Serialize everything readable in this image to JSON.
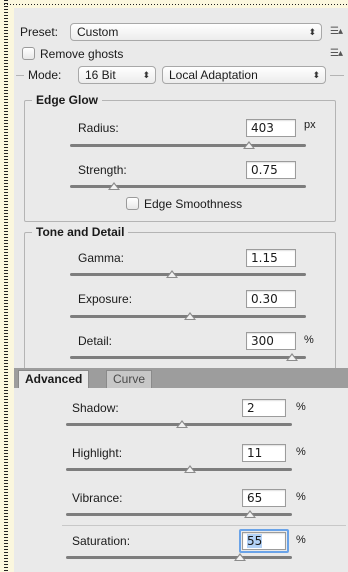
{
  "preset": {
    "label": "Preset:",
    "value": "Custom"
  },
  "remove_ghosts": {
    "label": "Remove ghosts",
    "checked": false
  },
  "mode": {
    "label": "Mode:",
    "bit_depth": "16 Bit",
    "method": "Local Adaptation"
  },
  "edge_glow": {
    "title": "Edge Glow",
    "radius": {
      "label": "Radius:",
      "value": "403",
      "unit": "px",
      "slider_fraction": 0.79
    },
    "strength": {
      "label": "Strength:",
      "value": "0.75",
      "slider_fraction": 0.19
    },
    "edge_smoothness": {
      "label": "Edge Smoothness",
      "checked": false
    }
  },
  "tone_detail": {
    "title": "Tone and Detail",
    "gamma": {
      "label": "Gamma:",
      "value": "1.15",
      "slider_fraction": 0.43
    },
    "exposure": {
      "label": "Exposure:",
      "value": "0.30",
      "slider_fraction": 0.57
    },
    "detail": {
      "label": "Detail:",
      "value": "300",
      "unit": "%",
      "slider_fraction": 0.99
    }
  },
  "tabs": {
    "advanced": "Advanced",
    "curve": "Curve"
  },
  "advanced": {
    "shadow": {
      "label": "Shadow:",
      "value": "2",
      "unit": "%",
      "slider_fraction": 0.51
    },
    "highlight": {
      "label": "Highlight:",
      "value": "11",
      "unit": "%",
      "slider_fraction": 0.55
    },
    "vibrance": {
      "label": "Vibrance:",
      "value": "65",
      "unit": "%",
      "slider_fraction": 0.82
    },
    "saturation": {
      "label": "Saturation:",
      "value": "55",
      "unit": "%",
      "slider_fraction": 0.78
    }
  },
  "icons": {
    "menu": "list-menu-icon",
    "select_arrows": "up-down-arrows-icon"
  }
}
